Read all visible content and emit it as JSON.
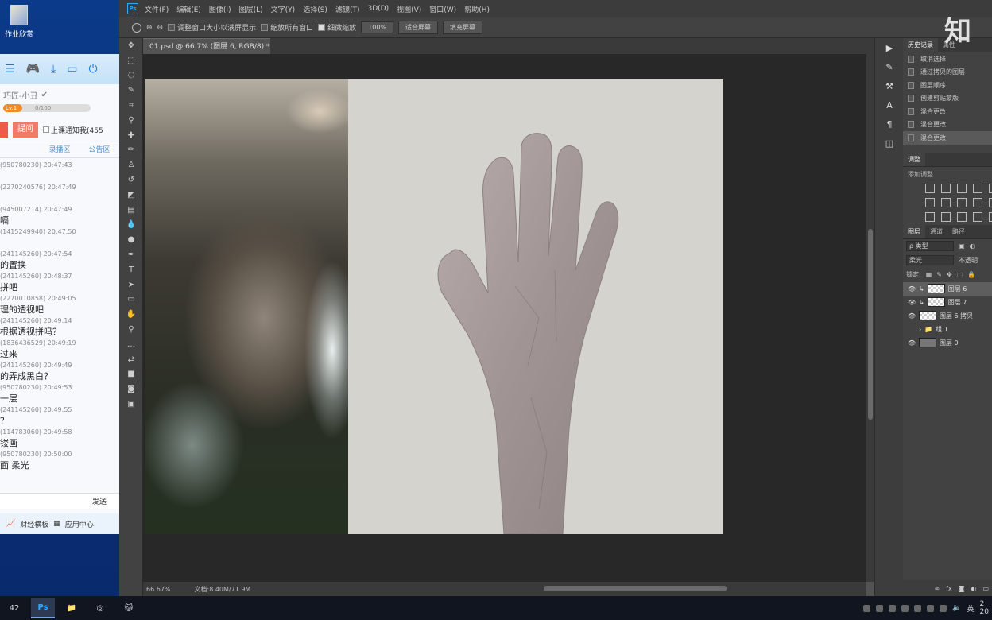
{
  "desktop": {
    "icon_label": "作业欣赏"
  },
  "chat": {
    "username": "巧匠-小丑",
    "level_badge": "Lv.1",
    "level_progress": "0/100",
    "ask_button": "提问",
    "notify_label": "上课通知我(455",
    "tabs": [
      "",
      "录播区",
      "公告区"
    ],
    "messages": [
      {
        "meta": "(950780230) 20:47:43",
        "text": ""
      },
      {
        "meta": "(2270240576) 20:47:49",
        "text": ""
      },
      {
        "meta": "(945007214) 20:47:49",
        "text": "嗝"
      },
      {
        "meta": "(1415249940) 20:47:50",
        "text": ""
      },
      {
        "meta": "(241145260) 20:47:54",
        "text": "的置换"
      },
      {
        "meta": "(241145260) 20:48:37",
        "text": "拼吧"
      },
      {
        "meta": "(2270010858) 20:49:05",
        "text": "理的透视吧"
      },
      {
        "meta": "(241145260) 20:49:14",
        "text": "根据透视拼吗？"
      },
      {
        "meta": "(1836436529) 20:49:19",
        "text": "过来"
      },
      {
        "meta": "(241145260) 20:49:49",
        "text": "的弄成黑白？"
      },
      {
        "meta": "(950780230) 20:49:53",
        "text": "一层"
      },
      {
        "meta": "(241145260) 20:49:55",
        "text": "？"
      },
      {
        "meta": "(114783060) 20:49:58",
        "text": "镂画"
      },
      {
        "meta": "(950780230) 20:50:00",
        "text": "面 柔光"
      }
    ],
    "send_label": "发送",
    "bottom_items": [
      "财经横板",
      "应用中心"
    ]
  },
  "photoshop": {
    "menu": [
      "文件(F)",
      "编辑(E)",
      "图像(I)",
      "图层(L)",
      "文字(Y)",
      "选择(S)",
      "滤镜(T)",
      "3D(D)",
      "视图(V)",
      "窗口(W)",
      "帮助(H)"
    ],
    "options": {
      "fit_window_label": "调整窗口大小以满屏显示",
      "zoom_all_label": "缩放所有窗口",
      "scrubby_label": "细微缩放",
      "zoom_value": "100%",
      "fit_screen": "适合屏幕",
      "fill_screen": "填充屏幕"
    },
    "doc_tab": "01.psd @ 66.7% (图层 6, RGB/8) *",
    "status": {
      "zoom": "66.67%",
      "doc_size": "文档:8.40M/71.9M"
    },
    "history": {
      "tab": "历史记录",
      "tab2": "属性",
      "items": [
        "取消选择",
        "通过拷贝的图层",
        "图层顺序",
        "创建剪贴蒙版",
        "混合更改",
        "混合更改",
        "混合更改"
      ],
      "selected_index": 6
    },
    "adjustments": {
      "tab": "调整",
      "add_label": "添加调整"
    },
    "layers": {
      "tabs": [
        "图层",
        "通道",
        "路径"
      ],
      "filter_label": "ρ 类型",
      "blend_mode": "柔光",
      "opacity_label": "不透明",
      "lock_label": "锁定:",
      "items": [
        {
          "name": "图层 6",
          "visible": true,
          "clipped": true
        },
        {
          "name": "图层 7",
          "visible": true,
          "clipped": true
        },
        {
          "name": "图层 6 拷贝",
          "visible": true,
          "clipped": false
        },
        {
          "name": "组 1",
          "visible": false,
          "clipped": false
        },
        {
          "name": "图层 0",
          "visible": true,
          "clipped": false
        }
      ],
      "selected_index": 0
    }
  },
  "watermark": "知",
  "taskbar": {
    "tray_lang": "英",
    "clock_fragment": "2",
    "year_fragment": "20",
    "weather": "42"
  }
}
